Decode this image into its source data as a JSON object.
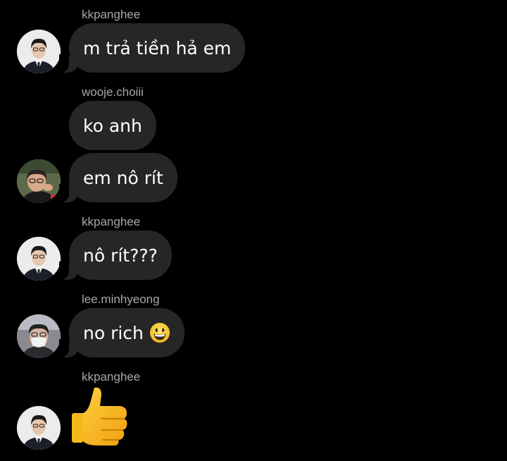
{
  "messages": [
    {
      "username": "kkpanghee",
      "text": "m trả tiền hả em",
      "avatar": "avatar-kkpanghee"
    },
    {
      "username": "wooje.choiii",
      "text": "ko anh",
      "avatar": null
    },
    {
      "username": null,
      "text": "em nô rít",
      "avatar": "avatar-wooje"
    },
    {
      "username": "kkpanghee",
      "text": "nô rít???",
      "avatar": "avatar-kkpanghee"
    },
    {
      "username": "lee.minhyeong",
      "text": "no rich",
      "emoji": "grinning-face-emoji",
      "avatar": "avatar-minhyeong"
    },
    {
      "username": "kkpanghee",
      "text": "",
      "emoji": "thumbs-up-emoji",
      "avatar": "avatar-kkpanghee"
    }
  ],
  "colors": {
    "background": "#000000",
    "bubble": "#262626",
    "username": "#a8a8a8",
    "text": "#ffffff"
  }
}
